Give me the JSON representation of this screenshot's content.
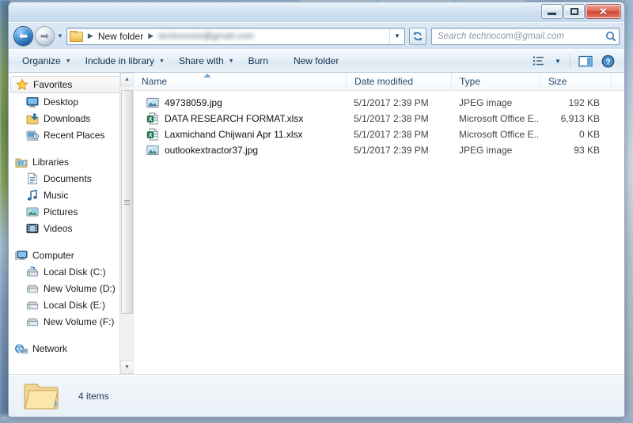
{
  "window": {
    "title": "",
    "controls": {
      "minimize": "Minimize",
      "maximize": "Restore",
      "close": "Close"
    }
  },
  "navbar": {
    "back_label": "Back",
    "forward_label": "Forward",
    "history_label": "Recent pages",
    "refresh_label": "Refresh",
    "breadcrumb": [
      {
        "label": "New folder"
      },
      {
        "label": "technocom@gmail.com",
        "redacted": true
      }
    ],
    "address_dropdown": "Previous locations",
    "search": {
      "placeholder": "Search technocom@gmail.com",
      "value": ""
    }
  },
  "commandbar": {
    "items": [
      {
        "label": "Organize",
        "has_menu": true
      },
      {
        "label": "Include in library",
        "has_menu": true
      },
      {
        "label": "Share with",
        "has_menu": true
      },
      {
        "label": "Burn",
        "has_menu": false
      },
      {
        "label": "New folder",
        "has_menu": false
      }
    ],
    "view_button": "Change your view",
    "view_dropdown": "More options",
    "preview_pane": "Show the preview pane",
    "help": "Get help"
  },
  "navpane": {
    "items": [
      {
        "label": "Favorites",
        "icon": "star-icon",
        "level": 0,
        "selected": true
      },
      {
        "label": "Desktop",
        "icon": "desktop-icon",
        "level": 1
      },
      {
        "label": "Downloads",
        "icon": "downloads-icon",
        "level": 1
      },
      {
        "label": "Recent Places",
        "icon": "recent-places-icon",
        "level": 1
      },
      {
        "gap": true
      },
      {
        "label": "Libraries",
        "icon": "libraries-icon",
        "level": 0
      },
      {
        "label": "Documents",
        "icon": "documents-icon",
        "level": 1
      },
      {
        "label": "Music",
        "icon": "music-icon",
        "level": 1
      },
      {
        "label": "Pictures",
        "icon": "pictures-icon",
        "level": 1
      },
      {
        "label": "Videos",
        "icon": "videos-icon",
        "level": 1
      },
      {
        "gap": true
      },
      {
        "label": "Computer",
        "icon": "computer-icon",
        "level": 0
      },
      {
        "label": "Local Disk (C:)",
        "icon": "local-disk-icon",
        "level": 1
      },
      {
        "label": "New Volume (D:)",
        "icon": "drive-icon",
        "level": 1
      },
      {
        "label": "Local Disk (E:)",
        "icon": "drive-icon",
        "level": 1
      },
      {
        "label": "New Volume (F:)",
        "icon": "drive-icon",
        "level": 1
      },
      {
        "gap": true
      },
      {
        "label": "Network",
        "icon": "network-icon",
        "level": 0
      }
    ],
    "scroll_up": "Scroll up",
    "scroll_down": "Scroll down"
  },
  "filelist": {
    "columns": [
      {
        "key": "name",
        "label": "Name",
        "sorted": true,
        "sort_dir": "asc"
      },
      {
        "key": "date",
        "label": "Date modified"
      },
      {
        "key": "type",
        "label": "Type"
      },
      {
        "key": "size",
        "label": "Size"
      }
    ],
    "rows": [
      {
        "name": "49738059.jpg",
        "date": "5/1/2017 2:39 PM",
        "type": "JPEG image",
        "size": "192 KB",
        "icon": "jpeg-file-icon"
      },
      {
        "name": "DATA RESEARCH FORMAT.xlsx",
        "date": "5/1/2017 2:38 PM",
        "type": "Microsoft Office E...",
        "size": "6,913 KB",
        "icon": "excel-file-icon"
      },
      {
        "name": "Laxmichand Chijwani Apr 11.xlsx",
        "date": "5/1/2017 2:38 PM",
        "type": "Microsoft Office E...",
        "size": "0 KB",
        "icon": "excel-file-icon"
      },
      {
        "name": "outlookextractor37.jpg",
        "date": "5/1/2017 2:39 PM",
        "type": "JPEG image",
        "size": "93 KB",
        "icon": "jpeg-file-icon"
      }
    ]
  },
  "statusbar": {
    "item_count": "4 items",
    "folder_icon": "folder-icon"
  },
  "colors": {
    "accent": "#2b6ca3",
    "close_button": "#cf4430",
    "header_text": "#2b4b6b",
    "excel_green": "#1e7145",
    "folder_yellow": "#f6cf72"
  }
}
